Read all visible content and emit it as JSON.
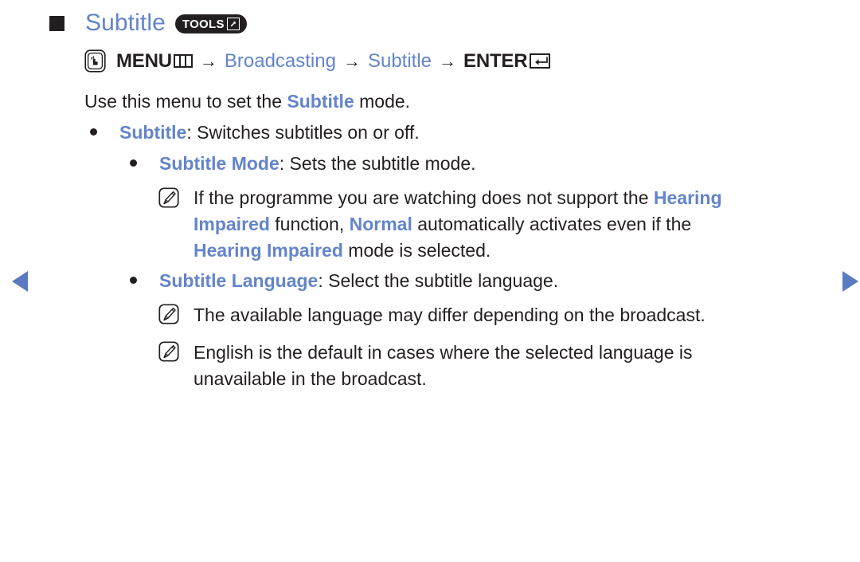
{
  "page": {
    "background": "#ffffff",
    "accent_blue": "#6384cb",
    "text_color": "#231f20"
  },
  "nav": {
    "prev_label": "Previous page",
    "next_label": "Next page"
  },
  "heading": {
    "title": "Subtitle",
    "badge_label": "TOOLS"
  },
  "menu_path": {
    "menu_label": "MENU",
    "arrow": "→",
    "step1": "Broadcasting",
    "step2": "Subtitle",
    "enter_label": "ENTER"
  },
  "intro": {
    "before": "Use this menu to set the ",
    "highlight": "Subtitle",
    "after": " mode."
  },
  "bullets": [
    {
      "term": "Subtitle",
      "rest": ": Switches subtitles on or off."
    },
    {
      "term": "Subtitle Mode",
      "rest": ": Sets the subtitle mode."
    },
    {
      "term": "Subtitle Language",
      "rest": ": Select the subtitle language."
    }
  ],
  "notes": {
    "note1": {
      "l1_a": "If the programme you are watching does not support the ",
      "l1_b": "Hearing",
      "l2_a": "Impaired",
      "l2_b": " function, ",
      "l2_c": "Normal",
      "l2_d": " automatically activates even if the",
      "l3_a": "Hearing Impaired",
      "l3_b": " mode is selected."
    },
    "note2": {
      "text": "The available language may differ depending on the broadcast."
    },
    "note3": {
      "l1": "English is the default in cases where the selected language is",
      "l2": "unavailable in the broadcast."
    }
  }
}
